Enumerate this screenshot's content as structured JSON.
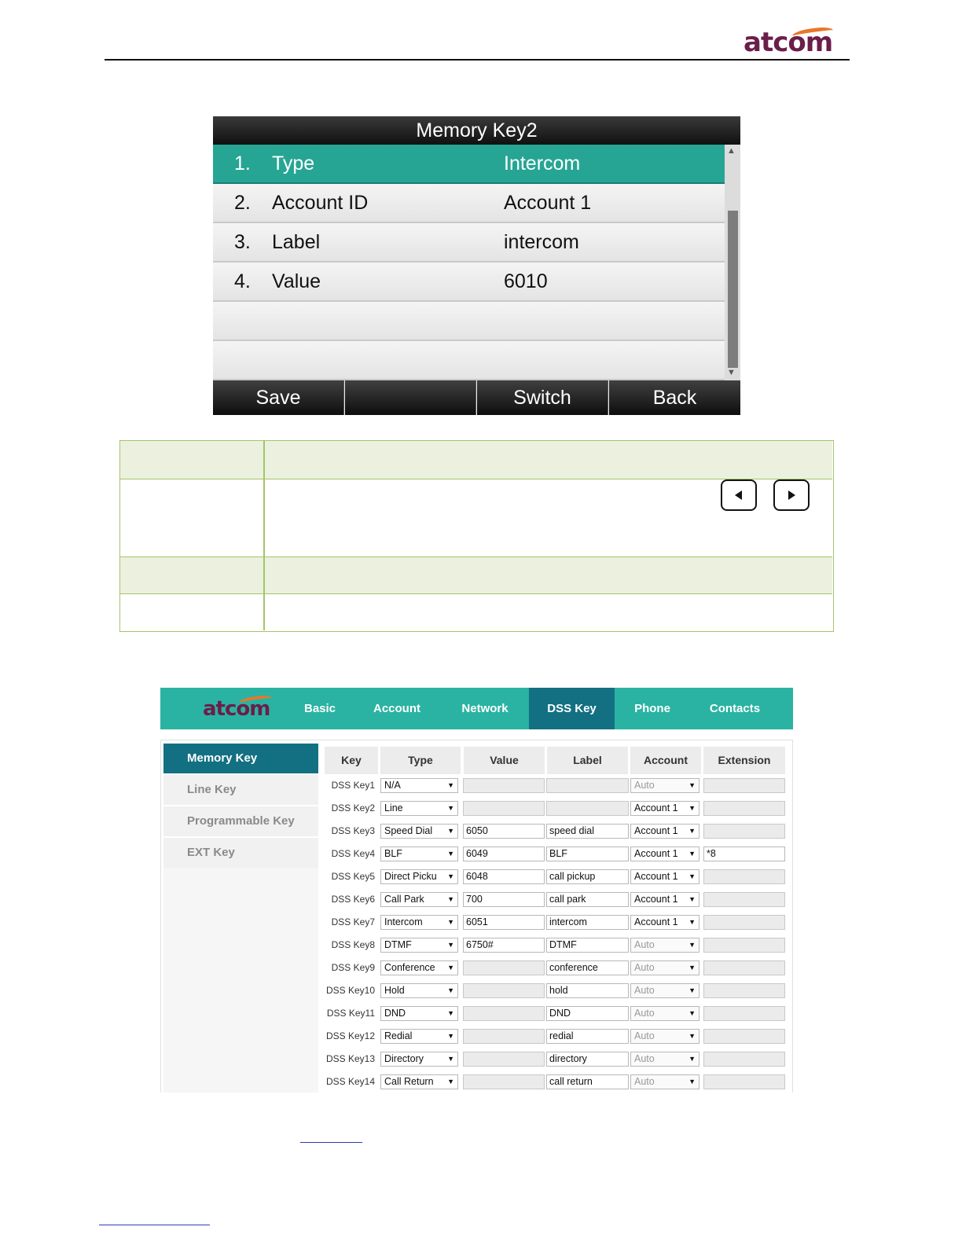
{
  "brand": {
    "logo_text": "atcom",
    "logo_color": "#6b1e4a",
    "swoosh_color": "#e8772a"
  },
  "phone": {
    "title": "Memory Key2",
    "rows": [
      {
        "num": "1.",
        "label": "Type",
        "value": "Intercom",
        "selected": true
      },
      {
        "num": "2.",
        "label": "Account ID",
        "value": "Account 1",
        "selected": false
      },
      {
        "num": "3.",
        "label": "Label",
        "value": "intercom",
        "selected": false
      },
      {
        "num": "4.",
        "label": "Value",
        "value": "6010",
        "selected": false
      }
    ],
    "softkeys": [
      "Save",
      "",
      "Switch",
      "Back"
    ],
    "selected_color": "#27a594"
  },
  "web": {
    "nav": {
      "logo_text": "atcom",
      "items": [
        "Basic",
        "Account",
        "Network",
        "DSS Key",
        "Phone",
        "Contacts"
      ],
      "active": "DSS Key"
    },
    "sidebar": {
      "items": [
        "Memory Key",
        "Line Key",
        "Programmable Key",
        "EXT Key"
      ],
      "active": "Memory Key"
    },
    "table": {
      "headers": [
        "Key",
        "Type",
        "Value",
        "Label",
        "Account",
        "Extension"
      ],
      "rows": [
        {
          "key": "DSS Key1",
          "type": "N/A",
          "value": "",
          "label": "",
          "account": "Auto",
          "account_disabled": true,
          "extension": ""
        },
        {
          "key": "DSS Key2",
          "type": "Line",
          "value": "",
          "label": "",
          "account": "Account 1",
          "account_disabled": false,
          "extension": ""
        },
        {
          "key": "DSS Key3",
          "type": "Speed Dial",
          "value": "6050",
          "label": "speed dial",
          "account": "Account 1",
          "account_disabled": false,
          "extension": ""
        },
        {
          "key": "DSS Key4",
          "type": "BLF",
          "value": "6049",
          "label": "BLF",
          "account": "Account 1",
          "account_disabled": false,
          "extension": "*8"
        },
        {
          "key": "DSS Key5",
          "type": "Direct Picku",
          "value": "6048",
          "label": "call pickup",
          "account": "Account 1",
          "account_disabled": false,
          "extension": ""
        },
        {
          "key": "DSS Key6",
          "type": "Call Park",
          "value": "700",
          "label": "call park",
          "account": "Account 1",
          "account_disabled": false,
          "extension": ""
        },
        {
          "key": "DSS Key7",
          "type": "Intercom",
          "value": "6051",
          "label": "intercom",
          "account": "Account 1",
          "account_disabled": false,
          "extension": ""
        },
        {
          "key": "DSS Key8",
          "type": "DTMF",
          "value": "6750#",
          "label": "DTMF",
          "account": "Auto",
          "account_disabled": true,
          "extension": ""
        },
        {
          "key": "DSS Key9",
          "type": "Conference",
          "value": "",
          "label": "conference",
          "account": "Auto",
          "account_disabled": true,
          "extension": ""
        },
        {
          "key": "DSS Key10",
          "type": "Hold",
          "value": "",
          "label": "hold",
          "account": "Auto",
          "account_disabled": true,
          "extension": ""
        },
        {
          "key": "DSS Key11",
          "type": "DND",
          "value": "",
          "label": "DND",
          "account": "Auto",
          "account_disabled": true,
          "extension": ""
        },
        {
          "key": "DSS Key12",
          "type": "Redial",
          "value": "",
          "label": "redial",
          "account": "Auto",
          "account_disabled": true,
          "extension": ""
        },
        {
          "key": "DSS Key13",
          "type": "Directory",
          "value": "",
          "label": "directory",
          "account": "Auto",
          "account_disabled": true,
          "extension": ""
        },
        {
          "key": "DSS Key14",
          "type": "Call Return",
          "value": "",
          "label": "call return",
          "account": "Auto",
          "account_disabled": true,
          "extension": ""
        }
      ]
    },
    "colors": {
      "nav_bg": "#2ab3a2",
      "active_bg": "#137082"
    }
  },
  "icons": {
    "nav_left": "left-arrow-key-icon",
    "nav_right": "right-arrow-key-icon",
    "dropdown": "dropdown-arrow-icon"
  }
}
